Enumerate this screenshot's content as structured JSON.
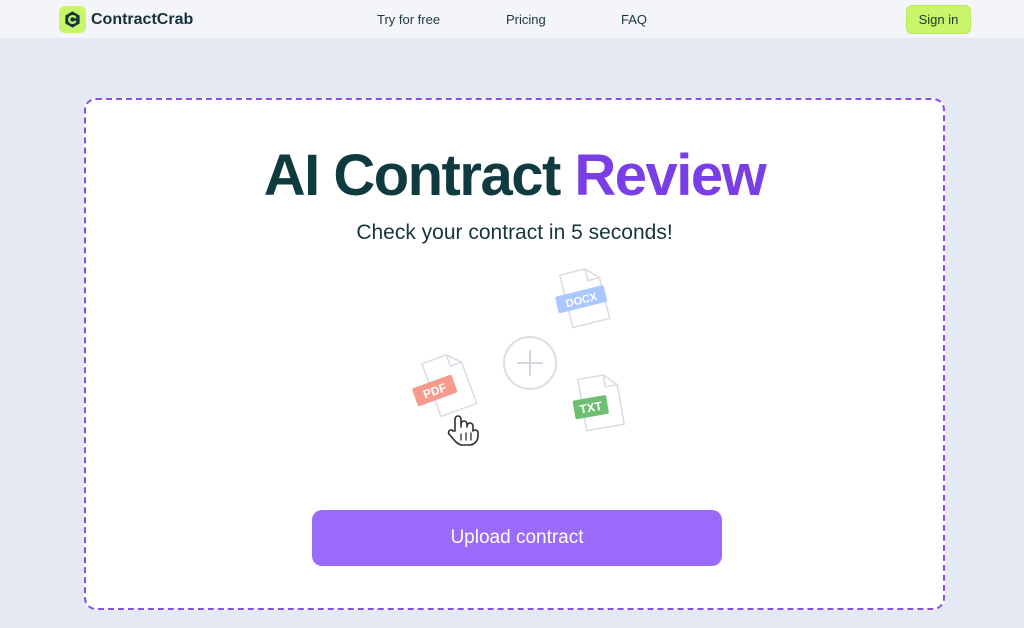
{
  "brand": {
    "name": "ContractCrab",
    "logo_icon": "c-hexagon-logo-icon",
    "accent": "#c8f56a"
  },
  "nav": {
    "items": [
      {
        "label": "Try for free"
      },
      {
        "label": "Pricing"
      },
      {
        "label": "FAQ"
      }
    ],
    "signin_label": "Sign in"
  },
  "hero": {
    "title_part1": "AI Contract",
    "title_part2": "Review",
    "subtitle": "Check your contract in 5 seconds!",
    "upload_label": "Upload contract",
    "border_color": "#8a4ee6",
    "button_color": "#9a6bfb"
  },
  "illustration": {
    "file_types": [
      {
        "label": "DOCX",
        "color": "#a9c8ff"
      },
      {
        "label": "PDF",
        "color": "#f59a8c"
      },
      {
        "label": "TXT",
        "color": "#6fbf73"
      }
    ],
    "icons": [
      "plus-circle-icon",
      "hand-cursor-icon"
    ]
  }
}
